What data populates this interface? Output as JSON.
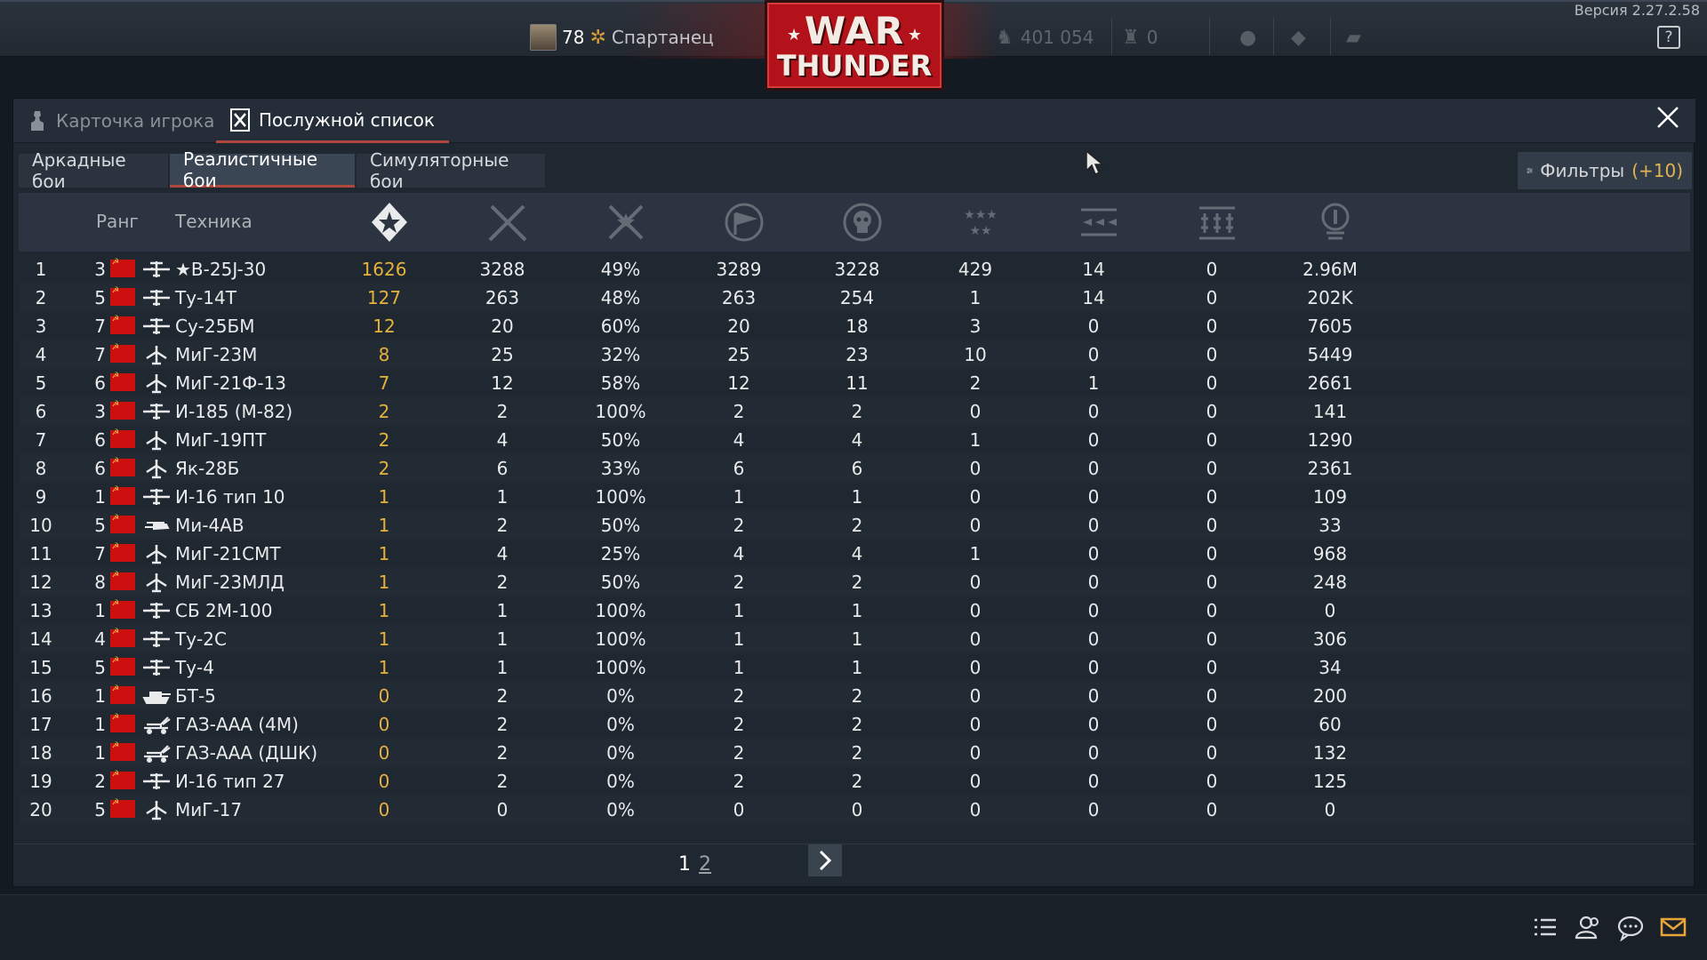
{
  "version_label": "Версия 2.27.2.58",
  "help_label": "?",
  "profile": {
    "level": "78",
    "nickname": "Спартанец"
  },
  "logo": {
    "line1": "WAR",
    "line2": "THUNDER"
  },
  "currency": {
    "silver_lions": "401 054",
    "golden_eagles": "0"
  },
  "tabs": [
    {
      "label": "Карточка игрока"
    },
    {
      "label": "Послужной список"
    }
  ],
  "modes": [
    {
      "label": "Аркадные бои"
    },
    {
      "label": "Реалистичные бои"
    },
    {
      "label": "Симуляторные бои"
    }
  ],
  "filters": {
    "label": "Фильтры",
    "count": "(+10)"
  },
  "headers": {
    "rank": "Ранг",
    "vehicle": "Техника"
  },
  "header_icons": [
    "victories-star-icon",
    "battles-swords-icon",
    "winrate-icon",
    "respawns-flag-icon",
    "deaths-skull-icon",
    "medals-stars-icon",
    "air-kills-icon",
    "ground-kills-icon",
    "score-icon"
  ],
  "rows": [
    {
      "n": "1",
      "rank": "3",
      "type": "plane",
      "name": "★B-25J-30",
      "wins": "1626",
      "battles": "3288",
      "pct": "49%",
      "resp": "3289",
      "deaths": "3228",
      "c6": "429",
      "c7": "14",
      "c8": "0",
      "score": "2.96M"
    },
    {
      "n": "2",
      "rank": "5",
      "type": "plane",
      "name": "Ту-14Т",
      "wins": "127",
      "battles": "263",
      "pct": "48%",
      "resp": "263",
      "deaths": "254",
      "c6": "1",
      "c7": "14",
      "c8": "0",
      "score": "202K"
    },
    {
      "n": "3",
      "rank": "7",
      "type": "plane",
      "name": "Су-25БМ",
      "wins": "12",
      "battles": "20",
      "pct": "60%",
      "resp": "20",
      "deaths": "18",
      "c6": "3",
      "c7": "0",
      "c8": "0",
      "score": "7605"
    },
    {
      "n": "4",
      "rank": "7",
      "type": "jet",
      "name": "МиГ-23М",
      "wins": "8",
      "battles": "25",
      "pct": "32%",
      "resp": "25",
      "deaths": "23",
      "c6": "10",
      "c7": "0",
      "c8": "0",
      "score": "5449"
    },
    {
      "n": "5",
      "rank": "6",
      "type": "jet",
      "name": "МиГ-21Ф-13",
      "wins": "7",
      "battles": "12",
      "pct": "58%",
      "resp": "12",
      "deaths": "11",
      "c6": "2",
      "c7": "1",
      "c8": "0",
      "score": "2661"
    },
    {
      "n": "6",
      "rank": "3",
      "type": "plane",
      "name": "И-185 (М-82)",
      "wins": "2",
      "battles": "2",
      "pct": "100%",
      "resp": "2",
      "deaths": "2",
      "c6": "0",
      "c7": "0",
      "c8": "0",
      "score": "141"
    },
    {
      "n": "7",
      "rank": "6",
      "type": "jet",
      "name": "МиГ-19ПТ",
      "wins": "2",
      "battles": "4",
      "pct": "50%",
      "resp": "4",
      "deaths": "4",
      "c6": "1",
      "c7": "0",
      "c8": "0",
      "score": "1290"
    },
    {
      "n": "8",
      "rank": "6",
      "type": "jet",
      "name": "Як-28Б",
      "wins": "2",
      "battles": "6",
      "pct": "33%",
      "resp": "6",
      "deaths": "6",
      "c6": "0",
      "c7": "0",
      "c8": "0",
      "score": "2361"
    },
    {
      "n": "9",
      "rank": "1",
      "type": "plane",
      "name": "И-16 тип 10",
      "wins": "1",
      "battles": "1",
      "pct": "100%",
      "resp": "1",
      "deaths": "1",
      "c6": "0",
      "c7": "0",
      "c8": "0",
      "score": "109"
    },
    {
      "n": "10",
      "rank": "5",
      "type": "heli",
      "name": "Ми-4АВ",
      "wins": "1",
      "battles": "2",
      "pct": "50%",
      "resp": "2",
      "deaths": "2",
      "c6": "0",
      "c7": "0",
      "c8": "0",
      "score": "33"
    },
    {
      "n": "11",
      "rank": "7",
      "type": "jet",
      "name": "МиГ-21СМТ",
      "wins": "1",
      "battles": "4",
      "pct": "25%",
      "resp": "4",
      "deaths": "4",
      "c6": "1",
      "c7": "0",
      "c8": "0",
      "score": "968"
    },
    {
      "n": "12",
      "rank": "8",
      "type": "jet",
      "name": "МиГ-23МЛД",
      "wins": "1",
      "battles": "2",
      "pct": "50%",
      "resp": "2",
      "deaths": "2",
      "c6": "0",
      "c7": "0",
      "c8": "0",
      "score": "248"
    },
    {
      "n": "13",
      "rank": "1",
      "type": "plane",
      "name": "СБ 2М-100",
      "wins": "1",
      "battles": "1",
      "pct": "100%",
      "resp": "1",
      "deaths": "1",
      "c6": "0",
      "c7": "0",
      "c8": "0",
      "score": "0"
    },
    {
      "n": "14",
      "rank": "4",
      "type": "plane",
      "name": "Ту-2С",
      "wins": "1",
      "battles": "1",
      "pct": "100%",
      "resp": "1",
      "deaths": "1",
      "c6": "0",
      "c7": "0",
      "c8": "0",
      "score": "306"
    },
    {
      "n": "15",
      "rank": "5",
      "type": "plane",
      "name": "Ту-4",
      "wins": "1",
      "battles": "1",
      "pct": "100%",
      "resp": "1",
      "deaths": "1",
      "c6": "0",
      "c7": "0",
      "c8": "0",
      "score": "34"
    },
    {
      "n": "16",
      "rank": "1",
      "type": "tank",
      "name": "БТ-5",
      "wins": "0",
      "battles": "2",
      "pct": "0%",
      "resp": "2",
      "deaths": "2",
      "c6": "0",
      "c7": "0",
      "c8": "0",
      "score": "200"
    },
    {
      "n": "17",
      "rank": "1",
      "type": "spaa",
      "name": "ГАЗ-ААА (4М)",
      "wins": "0",
      "battles": "2",
      "pct": "0%",
      "resp": "2",
      "deaths": "2",
      "c6": "0",
      "c7": "0",
      "c8": "0",
      "score": "60"
    },
    {
      "n": "18",
      "rank": "1",
      "type": "spaa",
      "name": "ГАЗ-ААА (ДШК)",
      "wins": "0",
      "battles": "2",
      "pct": "0%",
      "resp": "2",
      "deaths": "2",
      "c6": "0",
      "c7": "0",
      "c8": "0",
      "score": "132"
    },
    {
      "n": "19",
      "rank": "2",
      "type": "plane",
      "name": "И-16 тип 27",
      "wins": "0",
      "battles": "2",
      "pct": "0%",
      "resp": "2",
      "deaths": "2",
      "c6": "0",
      "c7": "0",
      "c8": "0",
      "score": "125"
    },
    {
      "n": "20",
      "rank": "5",
      "type": "jet",
      "name": "МиГ-17",
      "wins": "0",
      "battles": "0",
      "pct": "0%",
      "resp": "0",
      "deaths": "0",
      "c6": "0",
      "c7": "0",
      "c8": "0",
      "score": "0"
    }
  ],
  "pager": {
    "current": "1",
    "next": "2"
  },
  "colors": {
    "accent": "#b0473c",
    "gold": "#e5b23d",
    "flag": "#cc1010",
    "logo_red": "#b3121a"
  }
}
